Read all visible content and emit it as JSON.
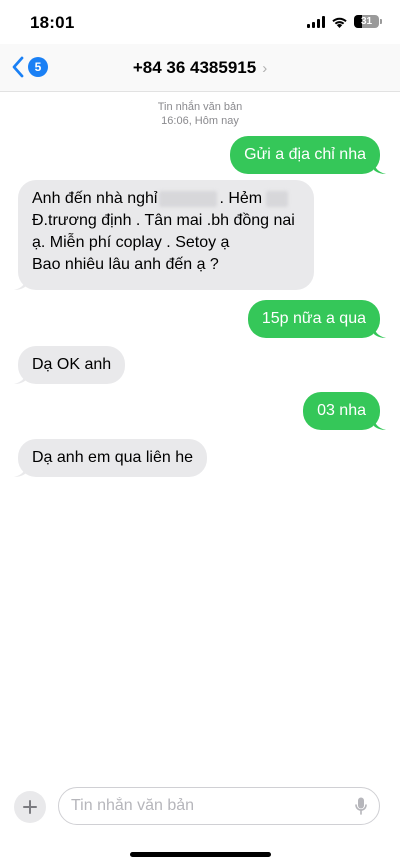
{
  "status": {
    "time": "18:01",
    "battery": "31"
  },
  "nav": {
    "back_count": "5",
    "contact": "+84 36 4385915"
  },
  "meta": {
    "label": "Tin nhắn văn bản",
    "timestamp": "16:06, Hôm nay"
  },
  "messages": [
    {
      "from": "me",
      "text": "Gửi a địa chỉ nha"
    },
    {
      "from": "them",
      "lines": [
        "Anh đến nhà nghỉ",
        ". Hẻm",
        "Đ.trương định . Tân mai .bh  đồng nai",
        "ạ. Miễn phí coplay . Setoy ạ",
        "Bao nhiêu lâu anh đến ạ ?"
      ]
    },
    {
      "from": "me",
      "text": "15p nữa a qua"
    },
    {
      "from": "them",
      "text": "Dạ OK anh"
    },
    {
      "from": "me",
      "text": "03 nha"
    },
    {
      "from": "them",
      "text": "Dạ anh em qua liên he"
    }
  ],
  "composer": {
    "placeholder": "Tin nhắn văn bản"
  },
  "colors": {
    "sent": "#35c759",
    "received": "#e9e9eb",
    "accent": "#1a80f5"
  },
  "icons": [
    "signal-icon",
    "wifi-icon",
    "battery-icon",
    "back-chevron-icon",
    "chevron-right-icon",
    "plus-icon",
    "microphone-icon"
  ]
}
